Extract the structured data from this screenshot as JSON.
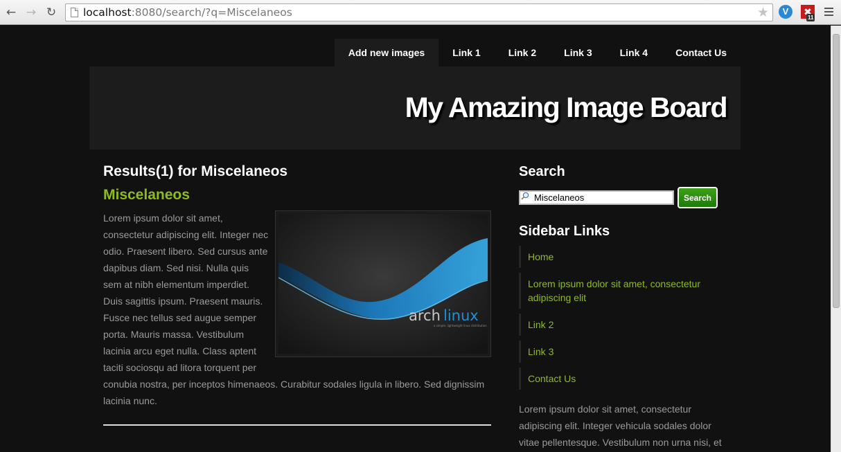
{
  "browser": {
    "url_host": "localhost",
    "url_path": ":8080/search/?q=Miscelaneos",
    "extension_badge": "11"
  },
  "nav": {
    "items": [
      {
        "label": "Add new images",
        "active": true
      },
      {
        "label": "Link 1"
      },
      {
        "label": "Link 2"
      },
      {
        "label": "Link 3"
      },
      {
        "label": "Link 4"
      },
      {
        "label": "Contact Us"
      }
    ]
  },
  "header": {
    "title": "My Amazing Image Board"
  },
  "main": {
    "results_title": "Results(1) for Miscelaneos",
    "post_title": "Miscelaneos",
    "post_body": "Lorem ipsum dolor sit amet, consectetur adipiscing elit. Integer nec odio. Praesent libero. Sed cursus ante dapibus diam. Sed nisi. Nulla quis sem at nibh elementum imperdiet. Duis sagittis ipsum. Praesent mauris. Fusce nec tellus sed augue semper porta. Mauris massa. Vestibulum lacinia arcu eget nulla. Class aptent taciti sociosqu ad litora torquent per conubia nostra, per inceptos himenaeos. Curabitur sodales ligula in libero. Sed dignissim lacinia nunc.",
    "image": {
      "logo_text_a": "arch",
      "logo_text_b": "linux",
      "logo_tagline": "a simple, lightweight linux distribution"
    }
  },
  "sidebar": {
    "search_heading": "Search",
    "search_value": "Miscelaneos",
    "search_button": "Search",
    "links_heading": "Sidebar Links",
    "links": [
      "Home",
      "Lorem ipsum dolor sit amet, consectetur adipiscing elit",
      "Link 2",
      "Link 3",
      "Contact Us"
    ],
    "text": "Lorem ipsum dolor sit amet, consectetur adipiscing elit. Integer vehicula sodales dolor vitae pellentesque. Vestibulum non urna nisi, et viverra nunc. Suspendisse vel posuere tellus."
  },
  "colors": {
    "accent": "#8fbb1f",
    "background": "#111111",
    "button_green": "#2e8f12"
  }
}
